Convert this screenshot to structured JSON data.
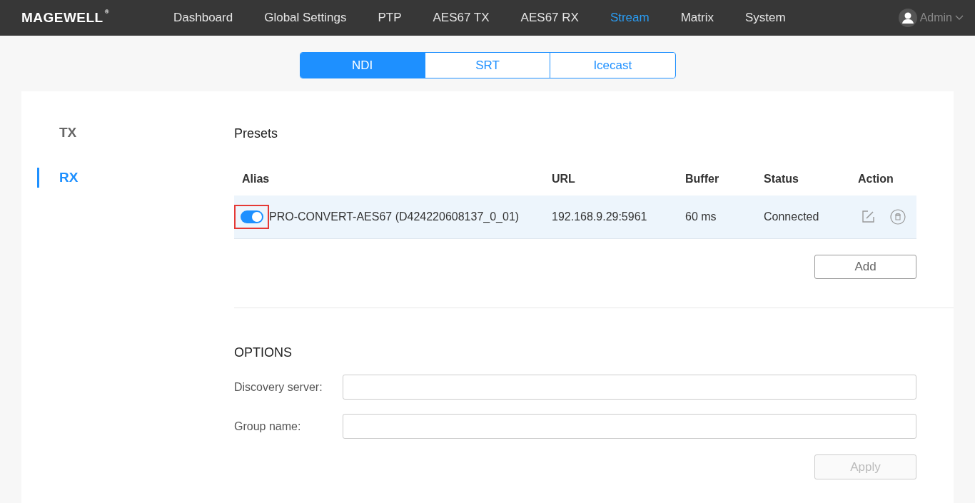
{
  "header": {
    "logo": "MAGEWELL",
    "logo_mark": "®",
    "nav": [
      {
        "label": "Dashboard",
        "selected": false
      },
      {
        "label": "Global Settings",
        "selected": false
      },
      {
        "label": "PTP",
        "selected": false
      },
      {
        "label": "AES67 TX",
        "selected": false
      },
      {
        "label": "AES67 RX",
        "selected": false
      },
      {
        "label": "Stream",
        "selected": true
      },
      {
        "label": "Matrix",
        "selected": false
      },
      {
        "label": "System",
        "selected": false
      }
    ],
    "user": "Admin"
  },
  "tabs": [
    {
      "label": "NDI",
      "selected": true
    },
    {
      "label": "SRT",
      "selected": false
    },
    {
      "label": "Icecast",
      "selected": false
    }
  ],
  "side_nav": [
    {
      "label": "TX",
      "selected": false
    },
    {
      "label": "RX",
      "selected": true
    }
  ],
  "presets": {
    "title": "Presets",
    "columns": [
      "Alias",
      "URL",
      "Buffer",
      "Status",
      "Action"
    ],
    "rows": [
      {
        "on": true,
        "highlighted": true,
        "alias": "PRO-CONVERT-AES67 (D424220608137_0_01)",
        "url": "192.168.9.29:5961",
        "buffer": "60 ms",
        "status": "Connected"
      }
    ],
    "add_button": "Add"
  },
  "options": {
    "title": "OPTIONS",
    "fields": [
      {
        "label": "Discovery server:"
      },
      {
        "label": "Group name:"
      }
    ],
    "apply_button": {
      "label": "Apply",
      "disabled": true
    }
  }
}
